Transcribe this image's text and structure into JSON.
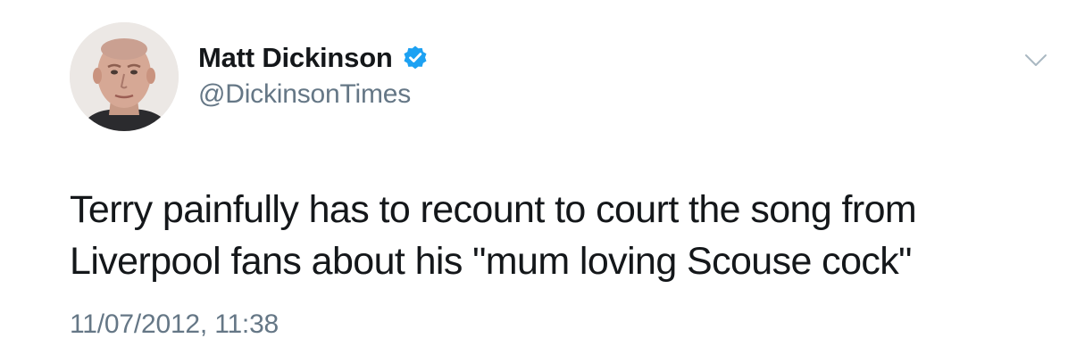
{
  "tweet": {
    "author_name": "Matt Dickinson",
    "author_handle": "@DickinsonTimes",
    "verified_icon": "verified-badge-icon",
    "menu_icon": "chevron-down-icon",
    "text_lines": [
      "Terry painfully has to recount to court the song from",
      "Liverpool fans about his \"mum loving Scouse cock\""
    ],
    "timestamp": "11/07/2012, 11:38"
  },
  "colors": {
    "text": "#14171a",
    "secondary": "#657786",
    "verified_blue": "#1da1f2",
    "chevron": "#aab8c2"
  }
}
